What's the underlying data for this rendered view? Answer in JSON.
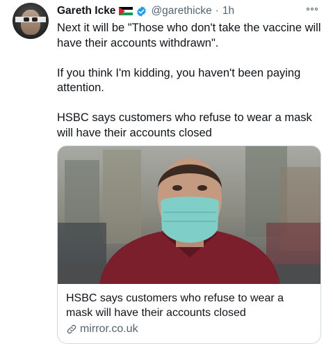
{
  "tweet": {
    "author_name": "Gareth Icke",
    "handle": "@garethicke",
    "separator": "·",
    "time": "1h",
    "icons": {
      "flag": "palestine-flag-icon",
      "verified": "verified-badge-icon",
      "more": "more-options-icon",
      "link": "link-icon"
    },
    "text": [
      "Next it will be \"Those who don't take the vaccine will have their accounts withdrawn\".",
      "If you think I'm kidding, you haven't been paying attention.",
      "HSBC says customers who refuse to wear a mask will have their accounts closed"
    ],
    "card": {
      "title": "HSBC says customers who refuse to wear a mask will have their accounts closed",
      "domain": "mirror.co.uk"
    }
  },
  "colors": {
    "text": "#0f1419",
    "secondary": "#536471",
    "border": "#cfd9de",
    "verified": "#1d9bf0",
    "mask": "#7fcfc8",
    "jacket": "#7a1f2b"
  }
}
